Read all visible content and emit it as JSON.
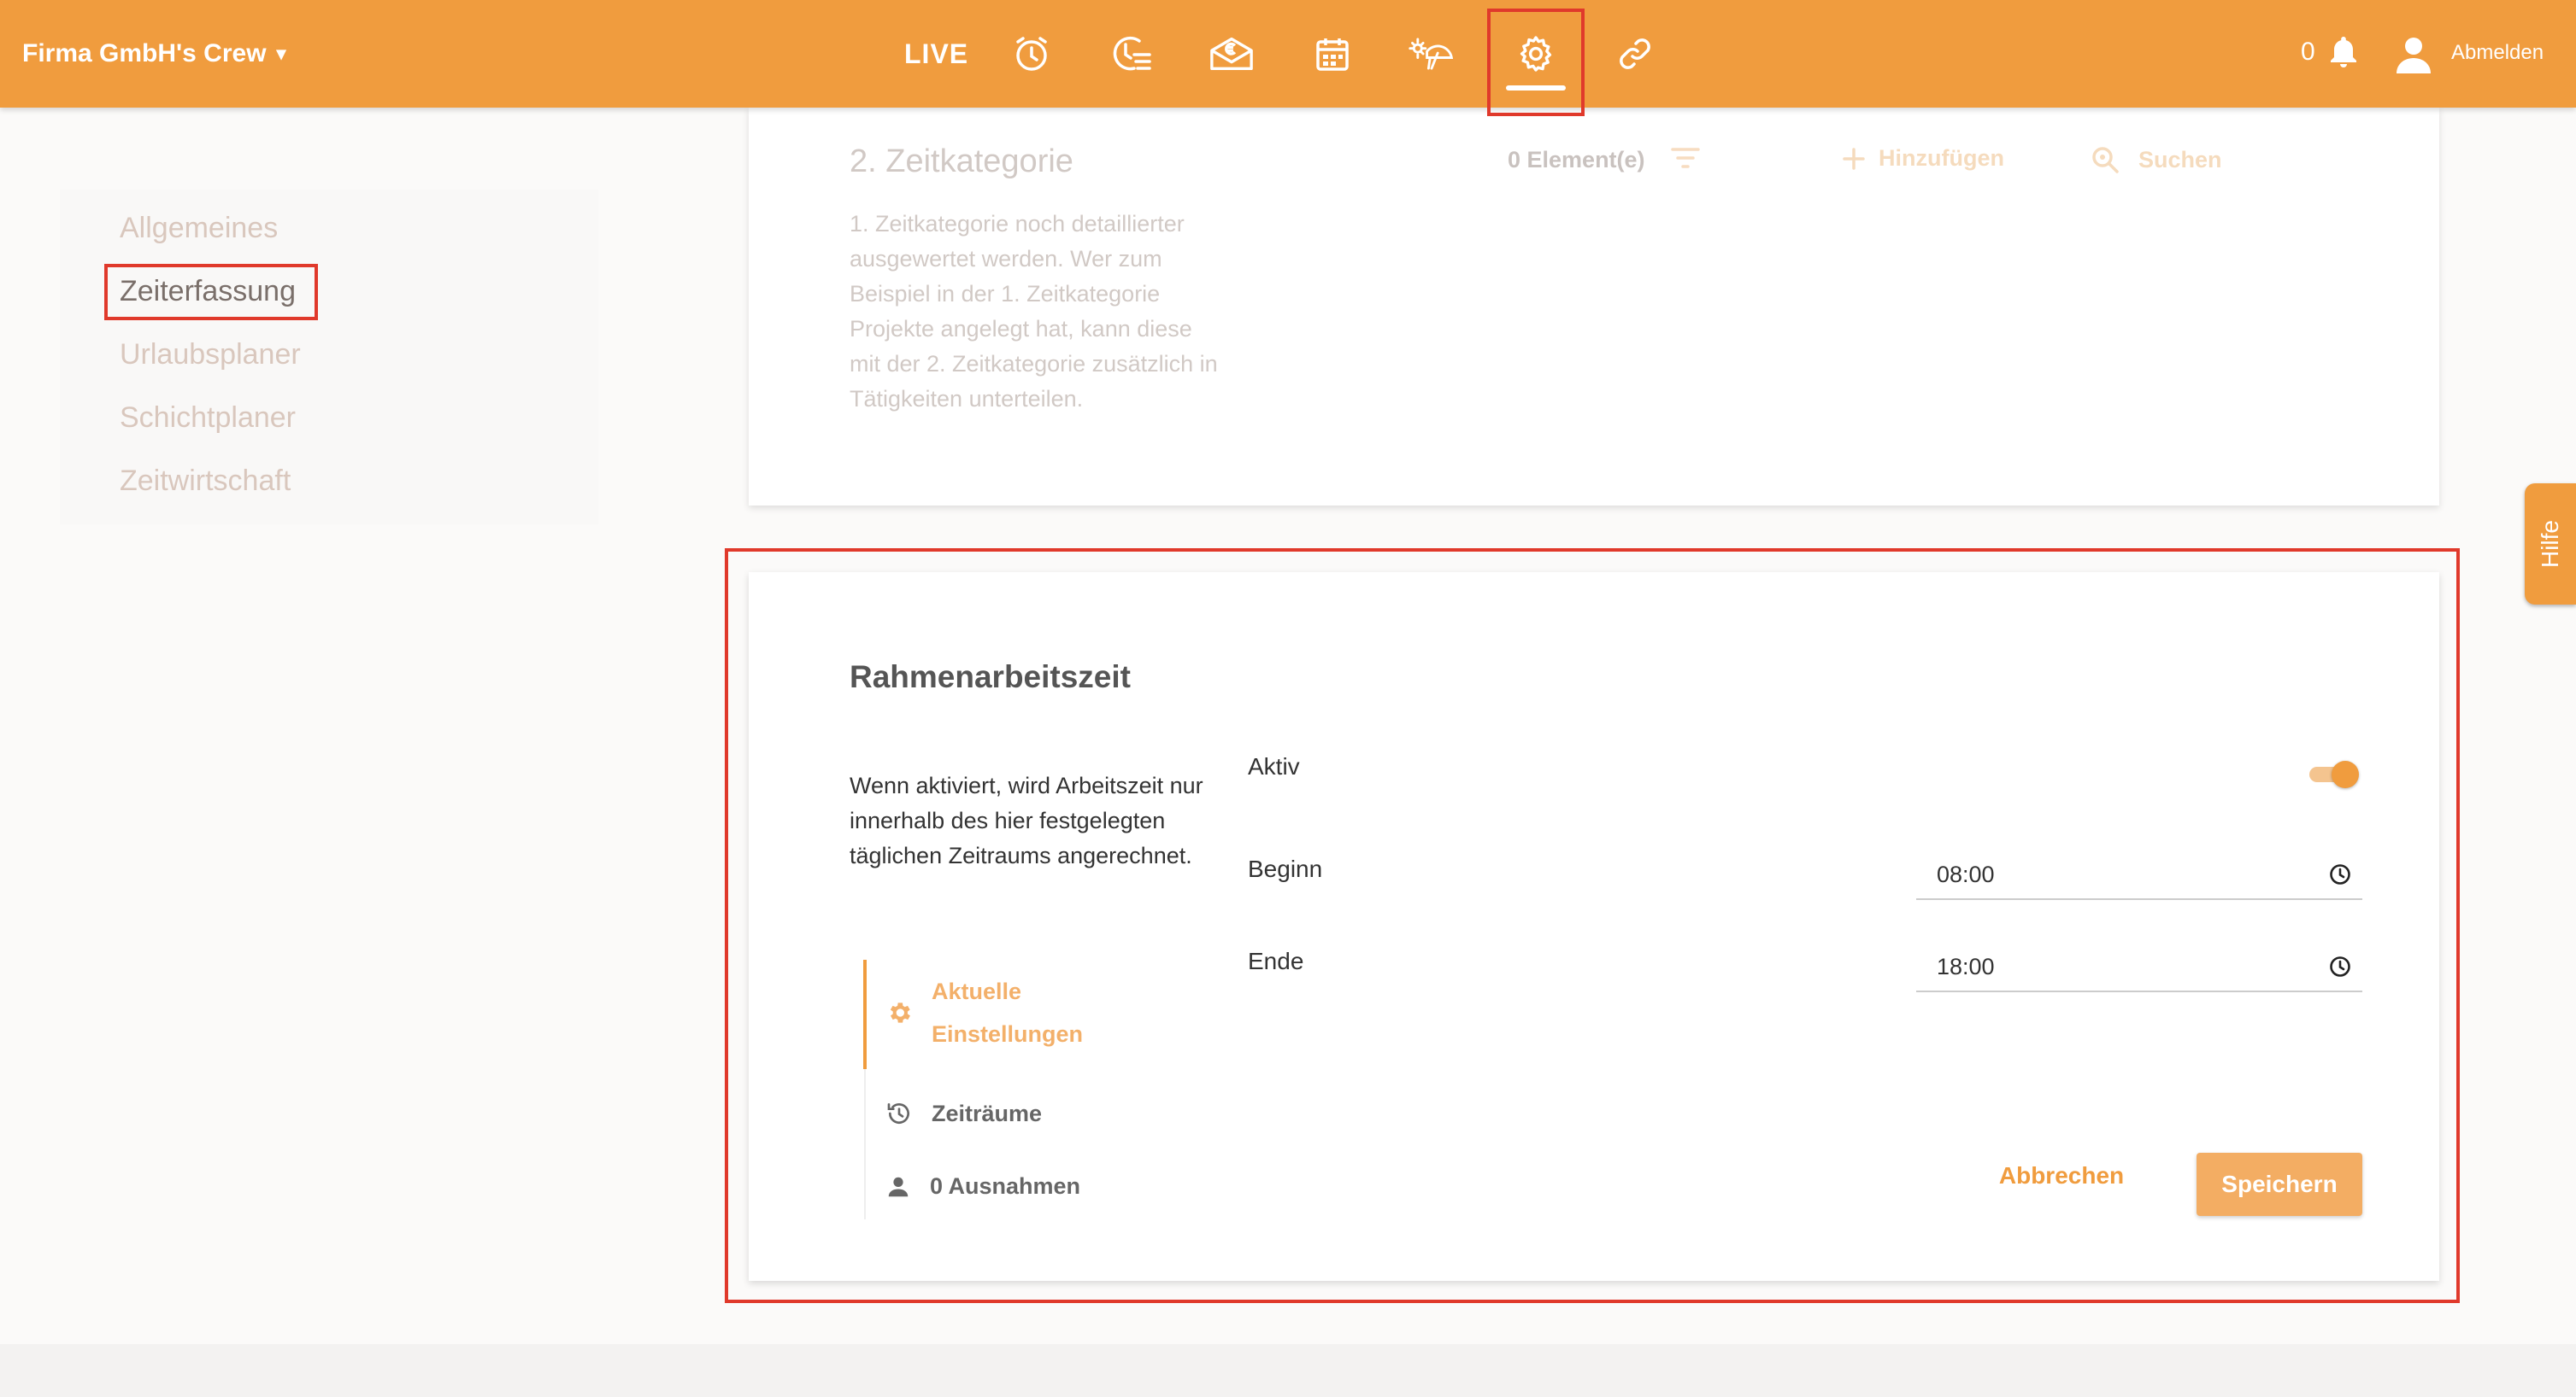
{
  "header": {
    "company": "Firma GmbH's Crew",
    "caret": "▾",
    "live": "LIVE",
    "nav_icons": [
      "clock-icon",
      "timeline-icon",
      "email-euro-icon",
      "calendar-icon",
      "vacation-icon",
      "settings-icon",
      "link-icon"
    ],
    "notification_count": "0",
    "logout": "Abmelden"
  },
  "sidebar": {
    "items": [
      {
        "label": "Allgemeines"
      },
      {
        "label": "Zeiterfassung"
      },
      {
        "label": "Urlaubsplaner"
      },
      {
        "label": "Schichtplaner"
      },
      {
        "label": "Zeitwirtschaft"
      }
    ],
    "active_index": 1
  },
  "time_category_card": {
    "title": "2. Zeitkategorie",
    "description": "1. Zeitkategorie noch detaillierter ausgewertet werden. Wer zum Beispiel in der 1. Zeitkategorie Projekte angelegt hat, kann diese mit der 2. Zeitkategorie zusätzlich in Tätigkeiten unterteilen.",
    "count": "0 Element(e)",
    "add_label": "Hinzufügen",
    "search_label": "Suchen"
  },
  "help_tab": "Hilfe",
  "frame_card": {
    "title": "Rahmenarbeitszeit",
    "description": "Wenn aktiviert, wird Arbeitszeit nur innerhalb des hier festgelegten täglichen Zeitraums angerechnet.",
    "active_label": "Aktiv",
    "active": true,
    "begin_label": "Beginn",
    "begin_value": "08:00",
    "end_label": "Ende",
    "end_value": "18:00",
    "steps": [
      {
        "label_line1": "Aktuelle",
        "label_line2": "Einstellungen",
        "icon": "gear-icon"
      },
      {
        "label": "Zeiträume",
        "icon": "history-icon"
      },
      {
        "label": "0 Ausnahmen",
        "icon": "person-icon"
      }
    ],
    "cancel_label": "Abbrechen",
    "save_label": "Speichern"
  },
  "colors": {
    "brand": "#f09c3e",
    "highlight": "#e0392b"
  }
}
